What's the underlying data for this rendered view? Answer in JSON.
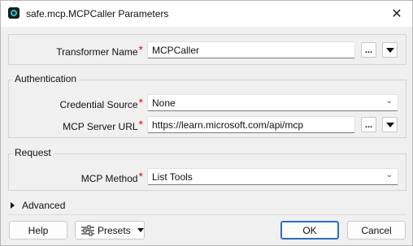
{
  "window": {
    "title": "safe.mcp.MCPCaller Parameters",
    "close_icon": "close-icon"
  },
  "transformer": {
    "label": "Transformer Name",
    "required_mark": "*",
    "value": "MCPCaller",
    "ellipsis": "..."
  },
  "authentication": {
    "group_label": "Authentication",
    "credential_source": {
      "label": "Credential Source",
      "required_mark": "*",
      "value": "None"
    },
    "server_url": {
      "label": "MCP Server URL",
      "required_mark": "*",
      "value": "https://learn.microsoft.com/api/mcp",
      "ellipsis": "..."
    }
  },
  "request": {
    "group_label": "Request",
    "method": {
      "label": "MCP Method",
      "required_mark": "*",
      "value": "List Tools"
    }
  },
  "advanced": {
    "label": "Advanced"
  },
  "footer": {
    "help": "Help",
    "presets": "Presets",
    "ok": "OK",
    "cancel": "Cancel"
  },
  "colors": {
    "required": "#d11111",
    "primary_border": "#2b6fc2",
    "app_icon_accent": "#23c5d8"
  }
}
